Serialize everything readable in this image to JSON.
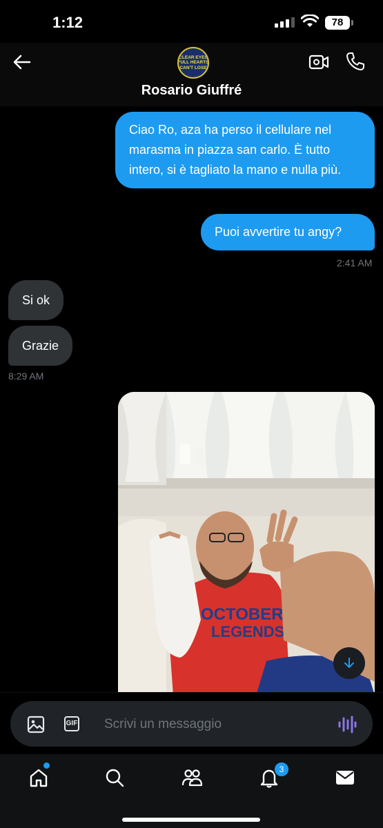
{
  "status_bar": {
    "time": "1:12",
    "battery": "78"
  },
  "header": {
    "contact_name": "Rosario Giuffré",
    "avatar_text": [
      "CLEAR EYES",
      "FULL HEARTS",
      "CAN'T LOSE"
    ]
  },
  "messages": {
    "out_1": "Ciao Ro, aza ha perso il cellulare nel marasma in piazza san carlo. È tutto intero, si è tagliato la mano e nulla più.",
    "out_2": "Puoi avvertire tu angy?",
    "time_out": "2:41 AM",
    "in_1": "Si ok",
    "in_2": "Grazie",
    "time_in": "8:29 AM"
  },
  "composer": {
    "placeholder": "Scrivi un messaggio",
    "gif_label": "GIF"
  },
  "tabbar": {
    "notifications_badge": "3"
  },
  "colors": {
    "accent": "#1d9bf0",
    "incoming_bubble": "#2f3336",
    "background": "#000000"
  }
}
